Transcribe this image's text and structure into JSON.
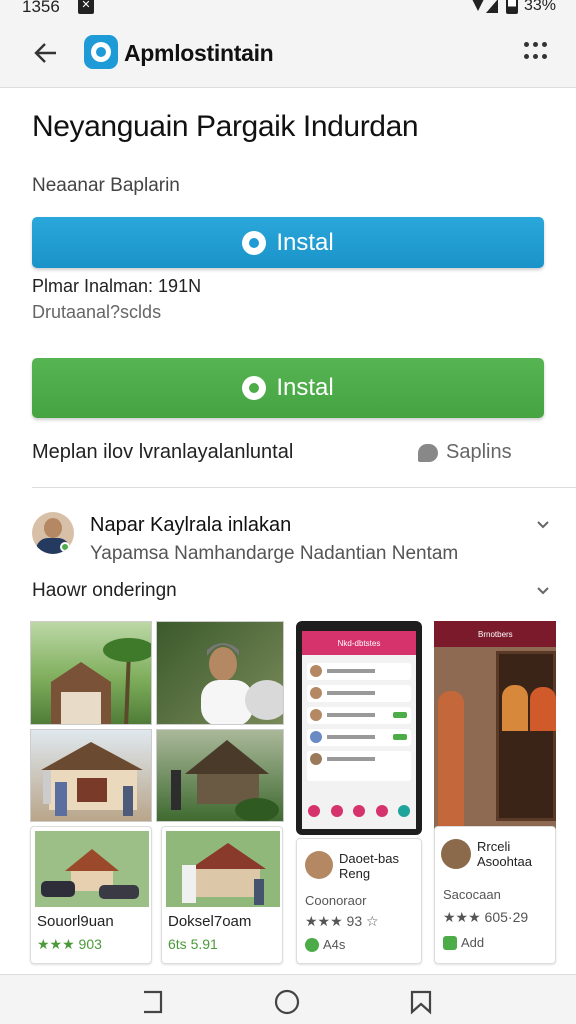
{
  "status_bar": {
    "time": "1356",
    "notif_icon": "x-app-icon",
    "battery": "33%"
  },
  "app_bar": {
    "title": "Apmlostintain",
    "back_icon": "arrow-back-icon",
    "menu_icon": "dots-grid-icon"
  },
  "header": {
    "title": "Neyanguain Pargaik Indurdan",
    "subtitle": "Neaanar Baplarin"
  },
  "primary_install": {
    "label": "Instal",
    "color": "#1e9ad6"
  },
  "meta": {
    "line1": "Plmar Inalman: 191N",
    "line2": "Drutaanal?sclds"
  },
  "secondary_install": {
    "label": "Instal",
    "color": "#4cad48"
  },
  "info_row": {
    "text": "Meplan ilov lvranlayalanluntal",
    "support_label": "Saplins"
  },
  "review": {
    "name": "Napar Kaylrala inlakan",
    "text": "Yapamsa Namhandarge Nadantian Nentam"
  },
  "gallery": {
    "title": "Haowr onderingn",
    "cards": [
      {
        "label": "Souorl9uan",
        "rating": "★★★ 903"
      },
      {
        "label": "Doksel7oam",
        "rating": "6ts 5.91"
      },
      {
        "label": "Daoet-bas Reng",
        "sub": "Coonoraor",
        "rating": "★★★ 93 ☆",
        "tag": "A4s"
      },
      {
        "label": "Rrceli Asoohtaa",
        "sub": "Sacocaan",
        "rating": "★★★ 605·29",
        "tag": "Add"
      }
    ]
  },
  "phone_screen": {
    "header": "Nkd-dbtstes"
  },
  "scene_screen": {
    "header": "Brnotbers"
  }
}
